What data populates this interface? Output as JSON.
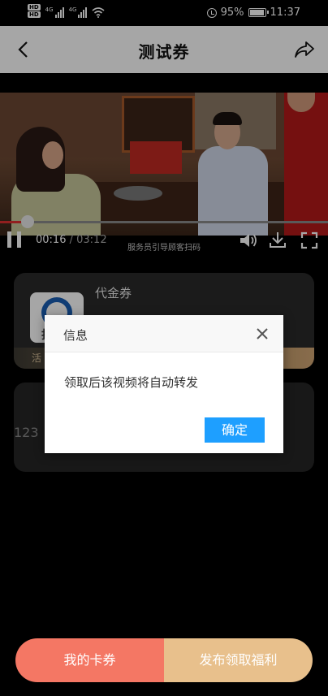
{
  "status_bar": {
    "hd_top": "HD",
    "hd_bottom": "HD",
    "net1": "4G",
    "net2": "4G",
    "battery": "95%",
    "battery_level": 0.95,
    "time": "11:37"
  },
  "header": {
    "title": "测试券",
    "back_icon": "chevron-left-icon",
    "share_icon": "share-icon"
  },
  "video": {
    "current_time": "00:16",
    "separator": " / ",
    "duration": "03:12",
    "progress": 0.083,
    "subtitle": "服务员引导顾客扫码",
    "icons": [
      "pause-icon",
      "volume-icon",
      "download-icon",
      "fullscreen-icon"
    ]
  },
  "voucher_card": {
    "title": "代金券",
    "logo_text": "拓",
    "strip_text": "活"
  },
  "second_card": {
    "text": "123"
  },
  "dialog": {
    "title": "信息",
    "message": "领取后该视频将自动转发",
    "confirm_label": "确定"
  },
  "bottom_bar": {
    "my_coupons_label": "我的卡券",
    "publish_label": "发布领取福利"
  },
  "colors": {
    "accent_blue": "#1e9fff",
    "coral": "#f47764",
    "gold": "#e8c08c",
    "progress_red": "#e03030"
  }
}
